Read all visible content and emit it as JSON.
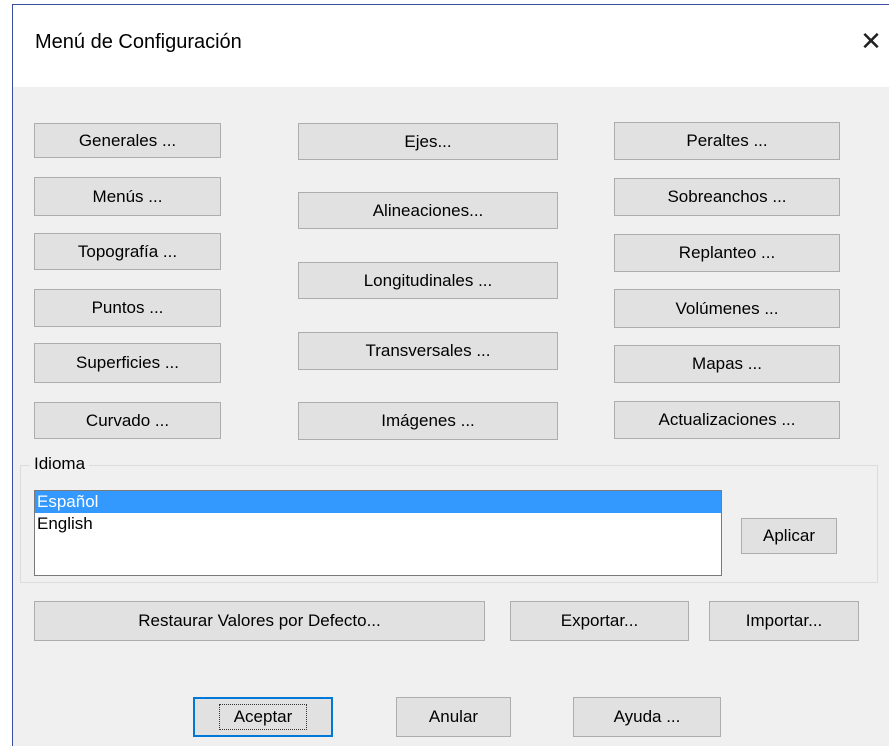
{
  "window": {
    "title": "Menú de Configuración",
    "close_glyph": "✕"
  },
  "buttons": {
    "generales": "Generales ...",
    "menus": "Menús ...",
    "topografia": "Topografía ...",
    "puntos": "Puntos ...",
    "superficies": "Superficies ...",
    "curvado": "Curvado ...",
    "ejes": "Ejes...",
    "alineaciones": "Alineaciones...",
    "longitudinales": "Longitudinales ...",
    "transversales": "Transversales ...",
    "imagenes": "Imágenes ...",
    "peraltes": "Peraltes ...",
    "sobreanchos": "Sobreanchos ...",
    "replanteo": "Replanteo ...",
    "volumenes": "Volúmenes ...",
    "mapas": "Mapas ...",
    "actualizaciones": "Actualizaciones ..."
  },
  "language": {
    "group_label": "Idioma",
    "items": [
      "Español",
      "English"
    ],
    "selected": "Español",
    "apply_label": "Aplicar"
  },
  "footer": {
    "restore_label": "Restaurar Valores por Defecto...",
    "export_label": "Exportar...",
    "import_label": "Importar...",
    "accept_label": "Aceptar",
    "cancel_label": "Anular",
    "help_label": "Ayuda ..."
  },
  "colors": {
    "window_bg": "#f0f0f0",
    "button_bg": "#e1e1e1",
    "selection": "#3399ff",
    "default_border": "#0078d7"
  },
  "icons": {
    "close": "close-icon"
  }
}
